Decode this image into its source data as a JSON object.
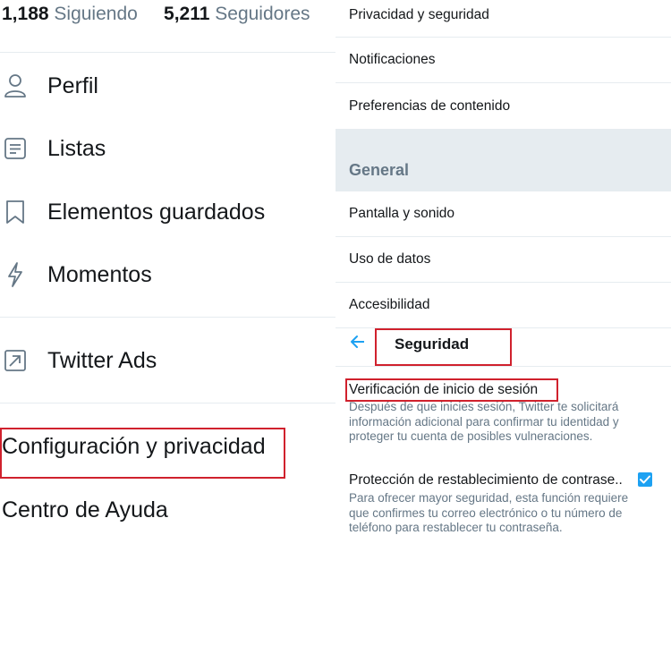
{
  "left": {
    "stats": {
      "following_count": "1,188",
      "following_label": "Siguiendo",
      "followers_count": "5,211",
      "followers_label": "Seguidores"
    },
    "menu": [
      {
        "label": "Perfil",
        "icon": "user-icon"
      },
      {
        "label": "Listas",
        "icon": "list-icon"
      },
      {
        "label": "Elementos guardados",
        "icon": "bookmark-icon"
      },
      {
        "label": "Momentos",
        "icon": "lightning-icon"
      }
    ],
    "ads": {
      "label": "Twitter Ads",
      "icon": "external-arrow-icon"
    },
    "settings_label": "Configuración y privacidad",
    "help_label": "Centro de Ayuda"
  },
  "right": {
    "settings_items": [
      "Privacidad y seguridad",
      "Notificaciones",
      "Preferencias de contenido"
    ],
    "general_header": "General",
    "general_items": [
      "Pantalla y sonido",
      "Uso de datos",
      "Accesibilidad"
    ],
    "security": {
      "title": "Seguridad",
      "back_icon": "arrow-left-icon",
      "login_verification": {
        "title": "Verificación de inicio de sesión",
        "description_line1": "Después de que inicies sesión, Twitter te solicitará",
        "description_line2": "información adicional para confirmar tu identidad y",
        "description_line3": "proteger tu cuenta de posibles vulneraciones."
      },
      "password_reset": {
        "title": "Protección de restablecimiento de contrase..",
        "checked": true,
        "description_line1": "Para ofrecer mayor seguridad, esta función requiere",
        "description_line2": "que confirmes tu correo electrónico o tu número de",
        "description_line3": "teléfono para restablecer tu contraseña."
      }
    }
  },
  "colors": {
    "accent": "#1da1f2",
    "highlight": "#d0212d",
    "muted": "#657786",
    "divider": "#e6ecf0"
  }
}
